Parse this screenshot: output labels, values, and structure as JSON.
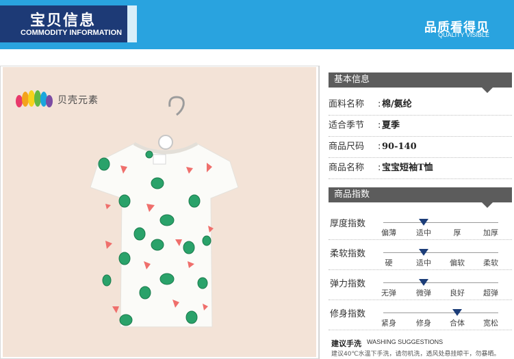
{
  "header": {
    "title": "宝贝信息",
    "subtitle": "COMMODITY INFORMATION",
    "right_title": "品质看得见",
    "right_subtitle": "QUALITY VISIBLE"
  },
  "brand": {
    "name": "贝壳元素",
    "logo_colors": [
      "#e8396b",
      "#f4a21d",
      "#f6d21c",
      "#62b845",
      "#1aa6dc",
      "#7b4ca3"
    ]
  },
  "basic_info": {
    "section_title": "基本信息",
    "rows": [
      {
        "label": "面料名称",
        "value": "棉/氨纶"
      },
      {
        "label": "适合季节",
        "value": "夏季"
      },
      {
        "label": "商品尺码",
        "value": "90-140"
      },
      {
        "label": "商品名称",
        "value": "宝宝短袖T恤"
      }
    ]
  },
  "index": {
    "section_title": "商品指数",
    "rows": [
      {
        "label": "厚度指数",
        "options": [
          "偏薄",
          "适中",
          "厚",
          "加厚"
        ],
        "selected": 1
      },
      {
        "label": "柔软指数",
        "options": [
          "硬",
          "适中",
          "偏软",
          "柔软"
        ],
        "selected": 1
      },
      {
        "label": "弹力指数",
        "options": [
          "无弹",
          "微弹",
          "良好",
          "超弹"
        ],
        "selected": 1
      },
      {
        "label": "修身指数",
        "options": [
          "紧身",
          "修身",
          "合体",
          "宽松"
        ],
        "selected": 2
      }
    ]
  },
  "washing": {
    "title": "建议手洗",
    "title_en": "WASHING SUGGESTIONS",
    "text": "建议40℃水温下手洗，请勿机洗，透风处悬挂晾干，勿暴晒。"
  },
  "colors": {
    "header_blue": "#29a3df",
    "header_navy": "#1d3a76",
    "section_grey": "#5c5c5c",
    "marker_navy": "#1c3d78",
    "photo_bg": "#f3e3d7",
    "watermelon_green": "#1f9a5c",
    "watermelon_red": "#ef6f6c"
  }
}
